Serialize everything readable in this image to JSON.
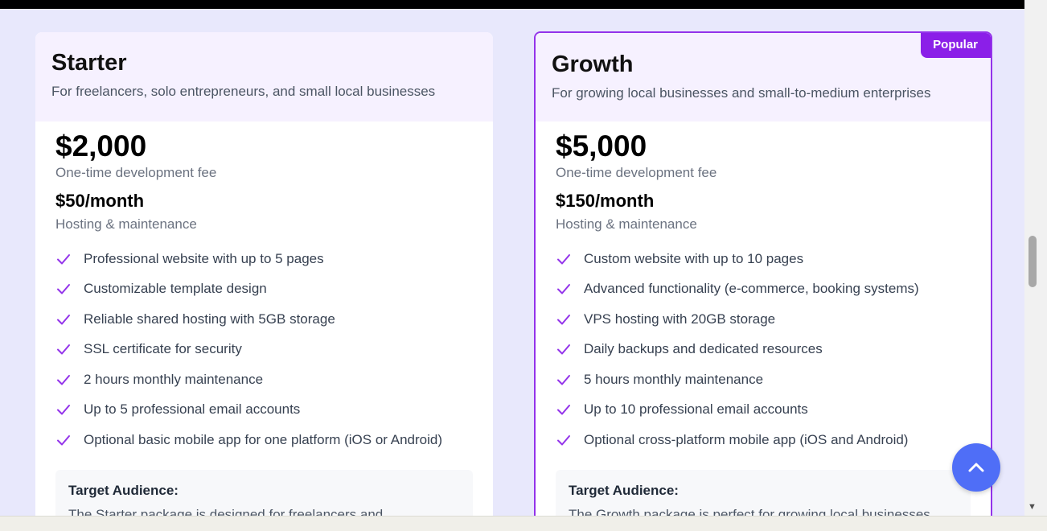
{
  "plans": [
    {
      "name": "Starter",
      "description": "For freelancers, solo entrepreneurs, and small local businesses",
      "price": "$2,000",
      "price_note": "One-time development fee",
      "monthly": "$50/month",
      "monthly_note": "Hosting & maintenance",
      "features": [
        "Professional website with up to 5 pages",
        "Customizable template design",
        "Reliable shared hosting with 5GB storage",
        "SSL certificate for security",
        "2 hours monthly maintenance",
        "Up to 5 professional email accounts",
        "Optional basic mobile app for one platform (iOS or Android)"
      ],
      "audience_title": "Target Audience:",
      "audience_text": "The Starter package is designed for freelancers and"
    },
    {
      "name": "Growth",
      "badge": "Popular",
      "description": "For growing local businesses and small-to-medium enterprises",
      "price": "$5,000",
      "price_note": "One-time development fee",
      "monthly": "$150/month",
      "monthly_note": "Hosting & maintenance",
      "features": [
        "Custom website with up to 10 pages",
        "Advanced functionality (e-commerce, booking systems)",
        "VPS hosting with 20GB storage",
        "Daily backups and dedicated resources",
        "5 hours monthly maintenance",
        "Up to 10 professional email accounts",
        "Optional cross-platform mobile app (iOS and Android)"
      ],
      "audience_title": "Target Audience:",
      "audience_text": "The Growth package is perfect for growing local businesses"
    }
  ],
  "icons": {
    "feature": "check-icon",
    "scroll_top": "chevron-up-icon"
  },
  "colors": {
    "accent": "#9333ea",
    "badge": "#8b1fe8",
    "header_bg": "#f6f1ff",
    "scroll_button": "#4f6ef7"
  }
}
